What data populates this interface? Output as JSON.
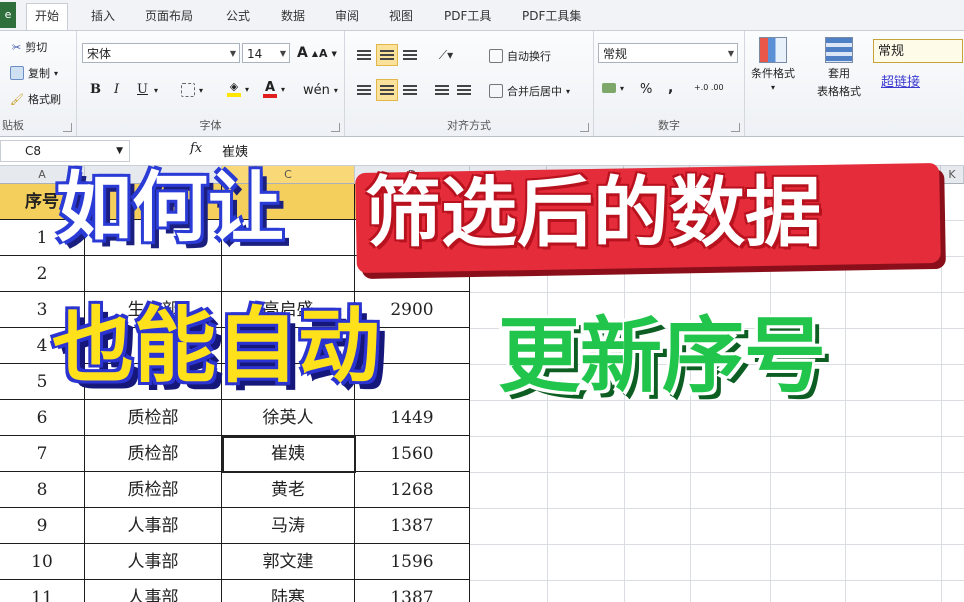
{
  "menu": {
    "file_label": "e",
    "tabs": [
      {
        "label": "开始",
        "active": true
      },
      {
        "label": "插入"
      },
      {
        "label": "页面布局"
      },
      {
        "label": "公式"
      },
      {
        "label": "数据"
      },
      {
        "label": "审阅"
      },
      {
        "label": "视图"
      },
      {
        "label": "PDF工具"
      },
      {
        "label": "PDF工具集"
      }
    ]
  },
  "ribbon": {
    "clipboard": {
      "cut": "剪切",
      "copy": "复制",
      "format_painter": "格式刷",
      "group": "贴板"
    },
    "font": {
      "name": "宋体",
      "size": "14",
      "bold": "B",
      "italic": "I",
      "underline": "U",
      "phonetic": "wén",
      "group": "字体",
      "grow": "A",
      "shrink": "A"
    },
    "alignment": {
      "wrap": "自动换行",
      "merge": "合并后居中",
      "group": "对齐方式"
    },
    "number": {
      "format": "常规",
      "percent": "%",
      "comma": ",",
      "inc": "+.0 .00",
      "group": "数字"
    },
    "styles": {
      "conditional": "条件格式",
      "table": "套用",
      "table2": "表格格式",
      "normal": "常规",
      "hyperlink": "超链接"
    }
  },
  "formula_bar": {
    "name_box": "C8",
    "fx": "fx",
    "value": "崔姨"
  },
  "sheet": {
    "col_headers": [
      "A",
      "B",
      "C",
      "D",
      "E",
      "F",
      "G",
      "H",
      "I",
      "J",
      "K"
    ],
    "header_row": [
      "序号",
      "",
      "",
      ""
    ],
    "rows": [
      [
        "1",
        "",
        "",
        ""
      ],
      [
        "2",
        "",
        "",
        ""
      ],
      [
        "3",
        "生产部",
        "高启盛",
        "2900"
      ],
      [
        "4",
        "",
        "",
        ""
      ],
      [
        "5",
        "",
        "",
        ""
      ],
      [
        "6",
        "质检部",
        "徐英人",
        "1449"
      ],
      [
        "7",
        "质检部",
        "崔姨",
        "1560"
      ],
      [
        "8",
        "质检部",
        "黄老",
        "1268"
      ],
      [
        "9",
        "人事部",
        "马涛",
        "1387"
      ],
      [
        "10",
        "人事部",
        "郭文建",
        "1596"
      ],
      [
        "11",
        "人事部",
        "陆寒",
        "1387"
      ]
    ]
  },
  "overlay": {
    "line1_a": "如何让",
    "line1_b": "筛选后的数据",
    "line2_a": "也能自动",
    "line2_b": "更新序号"
  }
}
